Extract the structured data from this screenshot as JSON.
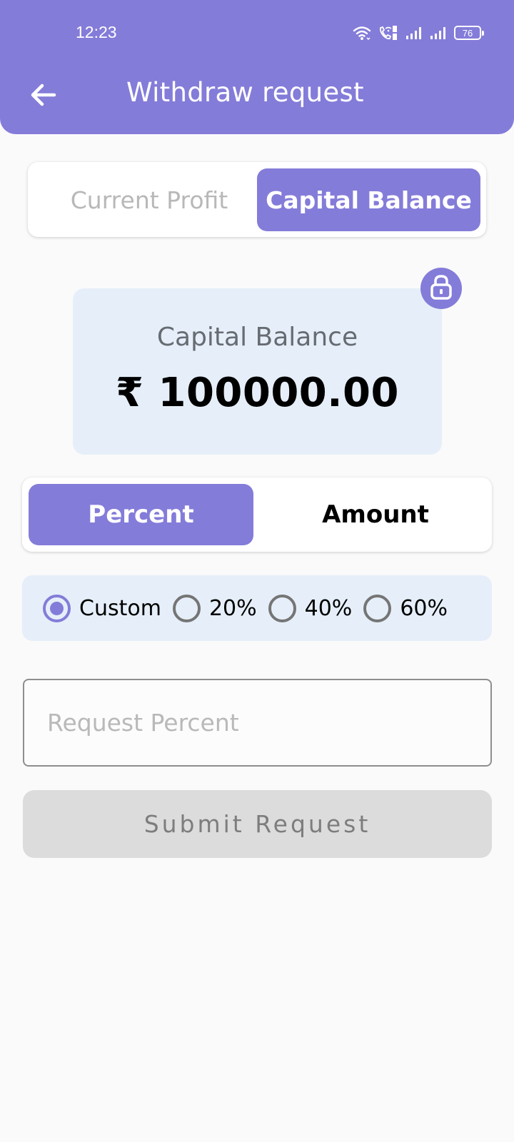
{
  "status_bar": {
    "time": "12:23",
    "battery": "76",
    "icons": [
      "wifi-icon",
      "wifi-calling-icon",
      "signal-sim1-icon",
      "signal-sim2-icon",
      "battery-icon"
    ]
  },
  "header": {
    "title": "Withdraw request",
    "back_icon": "arrow-left-icon"
  },
  "balance_tabs": {
    "items": [
      {
        "label": "Current Profit",
        "selected": false
      },
      {
        "label": "Capital Balance",
        "selected": true
      }
    ]
  },
  "balance_card": {
    "label": "Capital Balance",
    "value": "₹ 100000.00",
    "lock_icon": "lock-icon"
  },
  "mode_tabs": {
    "items": [
      {
        "label": "Percent",
        "selected": true
      },
      {
        "label": "Amount",
        "selected": false
      }
    ]
  },
  "preset_options": {
    "items": [
      {
        "label": "Custom",
        "checked": true
      },
      {
        "label": "20%",
        "checked": false
      },
      {
        "label": "40%",
        "checked": false
      },
      {
        "label": "60%",
        "checked": false
      }
    ]
  },
  "request_input": {
    "value": "",
    "placeholder": "Request Percent"
  },
  "submit": {
    "label": "Submit Request",
    "enabled": false
  },
  "colors": {
    "accent": "#847cd9",
    "card_bg": "#e6eff9",
    "disabled_bg": "#dcdcdc",
    "page_bg": "#fafafa"
  }
}
